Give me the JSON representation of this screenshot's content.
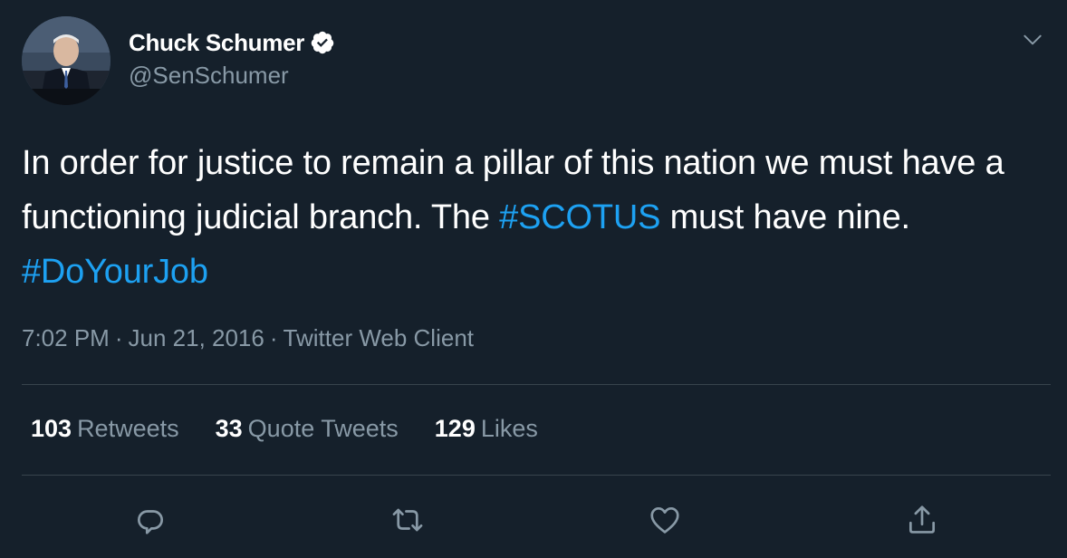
{
  "user": {
    "display_name": "Chuck Schumer",
    "handle": "@SenSchumer",
    "verified_icon": "verified-badge-icon",
    "avatar": "profile-photo"
  },
  "tweet": {
    "text_part1": "In order for justice to remain a pillar of this nation we must have a functioning judicial branch. The ",
    "hashtag1": "#SCOTUS",
    "text_part2": " must have nine. ",
    "hashtag2": "#DoYourJob"
  },
  "meta": {
    "time": "7:02 PM",
    "date": "Jun 21, 2016",
    "separator": "·",
    "source": "Twitter Web Client"
  },
  "stats": {
    "retweets_count": "103",
    "retweets_label": "Retweets",
    "quotes_count": "33",
    "quotes_label": "Quote Tweets",
    "likes_count": "129",
    "likes_label": "Likes"
  },
  "actions": {
    "reply_icon": "reply-icon",
    "retweet_icon": "retweet-icon",
    "like_icon": "heart-icon",
    "share_icon": "share-icon"
  },
  "colors": {
    "background": "#15202b",
    "primary_text": "#ffffff",
    "secondary_text": "#8899a6",
    "link": "#1da1f2",
    "divider": "#38444d"
  }
}
